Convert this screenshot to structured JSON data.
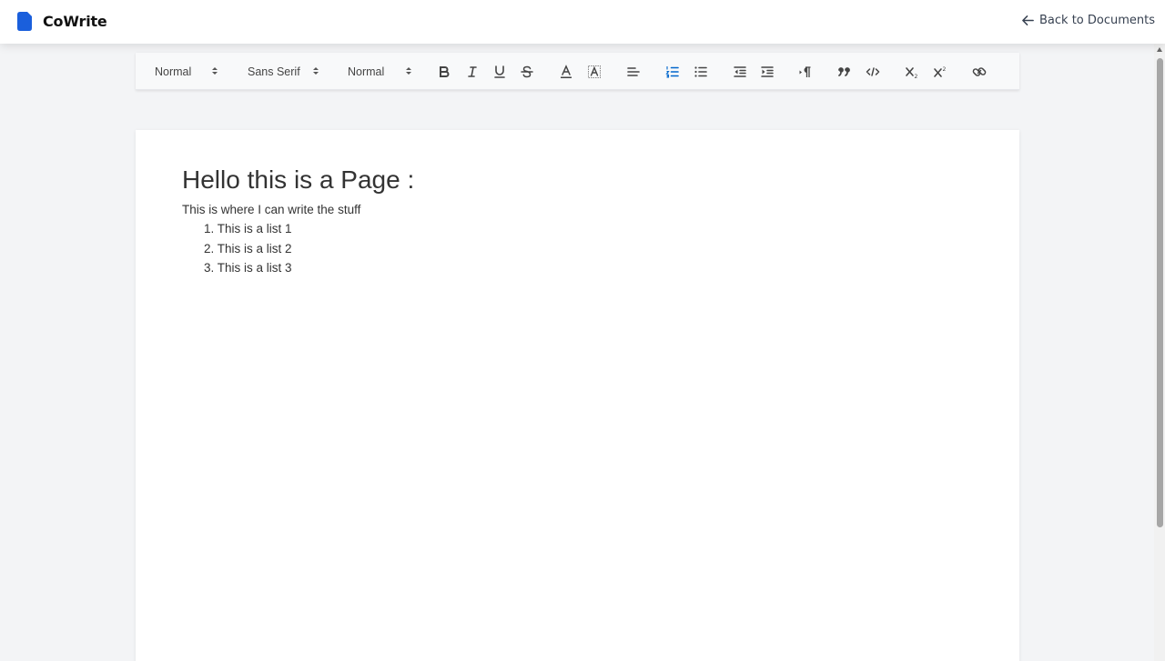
{
  "header": {
    "app_title": "CoWrite",
    "back_label": "Back to Documents",
    "brand_color": "#1a5fdc"
  },
  "toolbar": {
    "header_picker": "Normal",
    "font_picker": "Sans Serif",
    "size_picker": "Normal",
    "buttons": [
      "bold-icon",
      "italic-icon",
      "underline-icon",
      "strikethrough-icon",
      "text-color-icon",
      "background-color-icon",
      "align-icon",
      "ordered-list-icon",
      "bullet-list-icon",
      "outdent-icon",
      "indent-icon",
      "text-direction-icon",
      "blockquote-icon",
      "code-block-icon",
      "subscript-icon",
      "superscript-icon",
      "link-icon"
    ],
    "active_button": "ordered-list-icon",
    "active_color": "#0066cc"
  },
  "document": {
    "heading": "Hello this is a Page :",
    "paragraph": "This is where I can write the stuff",
    "list": [
      "1. This is a list 1",
      "2. This is a list 2",
      "3. This is a list 3"
    ]
  }
}
